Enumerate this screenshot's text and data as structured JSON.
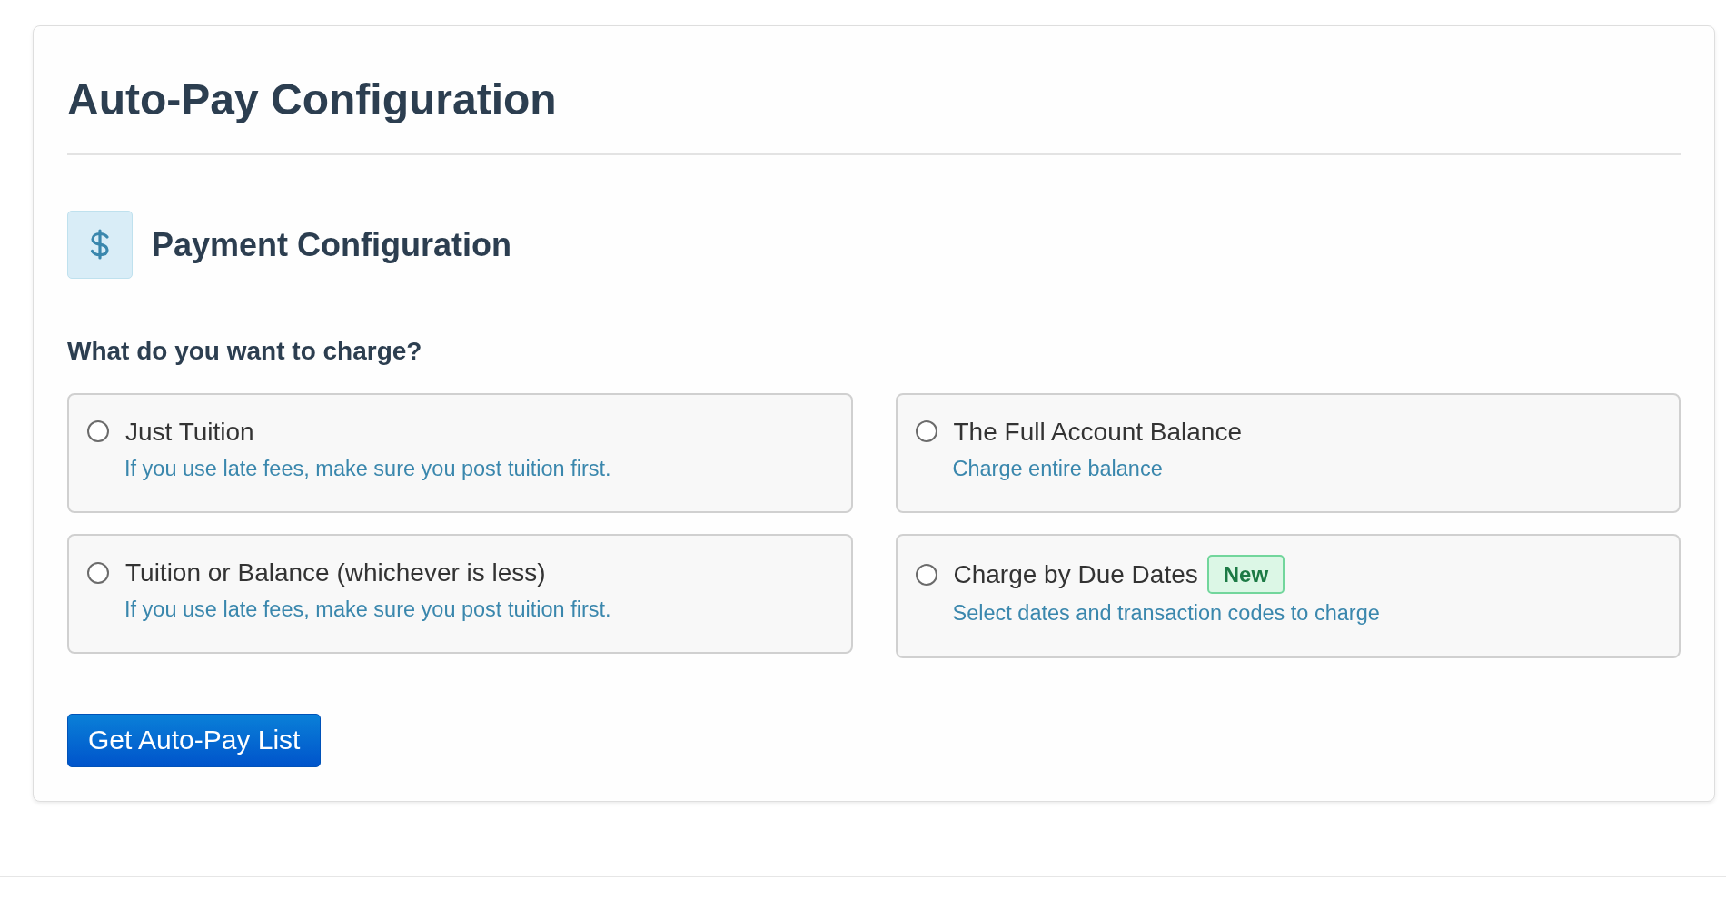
{
  "page": {
    "title": "Auto-Pay Configuration"
  },
  "section": {
    "title": "Payment Configuration",
    "question": "What do you want to charge?",
    "options": [
      {
        "label": "Just Tuition",
        "description": "If you use late fees, make sure you post tuition first.",
        "selected": false
      },
      {
        "label": "The Full Account Balance",
        "description": "Charge entire balance",
        "selected": false
      },
      {
        "label": "Tuition or Balance (whichever is less)",
        "description": "If you use late fees, make sure you post tuition first.",
        "selected": false
      },
      {
        "label": "Charge by Due Dates",
        "badge": "New",
        "description": "Select dates and transaction codes to charge",
        "selected": false
      }
    ],
    "submit_button": "Get Auto-Pay List"
  }
}
